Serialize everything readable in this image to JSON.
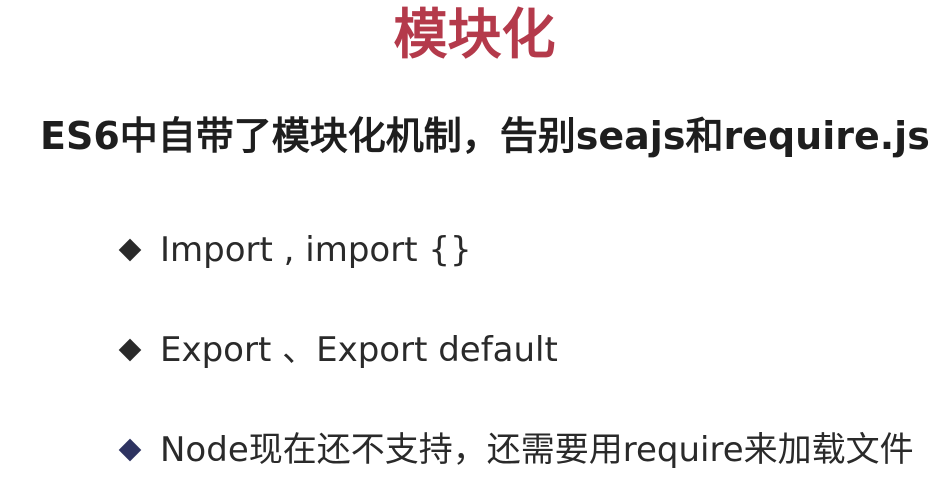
{
  "slide": {
    "title": "模块化",
    "subtitle": "ES6中自带了模块化机制，告别seajs和require.js",
    "bullets": [
      {
        "icon": "diamond-bullet-icon",
        "text": "Import , import {}"
      },
      {
        "icon": "diamond-bullet-icon",
        "text": "Export 、Export default"
      },
      {
        "icon": "diamond-bullet-icon",
        "text": "Node现在还不支持，还需要用require来加载文件"
      }
    ]
  },
  "colors": {
    "title": "#b43a4b",
    "text": "#2a2a2a",
    "bullet_accent": "#2e3361"
  }
}
